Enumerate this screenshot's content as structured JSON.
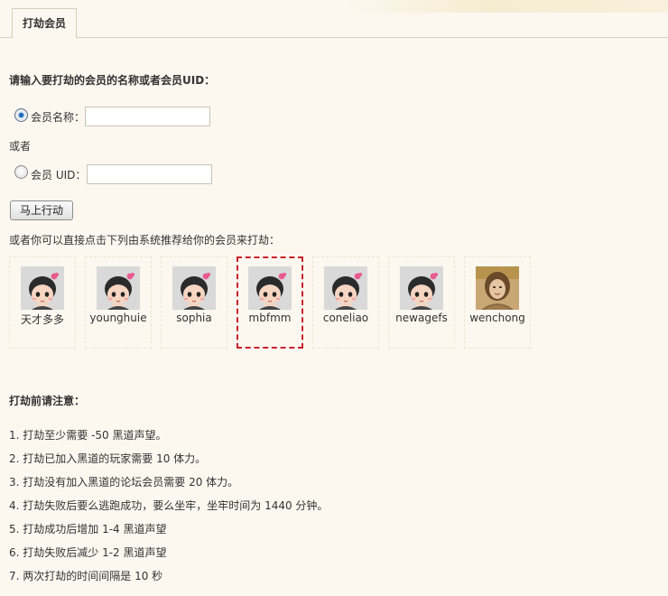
{
  "tab": {
    "label": "打劫会员"
  },
  "form": {
    "heading": "请输入要打劫的会员的名称或者会员UID：",
    "name_label": "会员名称：",
    "or_label": "或者",
    "uid_label": "会员 UID：",
    "name_value": "",
    "uid_value": "",
    "submit_label": "马上行动"
  },
  "recommend": {
    "label": "或者你可以直接点击下列由系统推荐给你的会员来打劫：",
    "members": [
      {
        "name": "天才多多",
        "avatar": "default-avatar",
        "selected": false
      },
      {
        "name": "younghuie",
        "avatar": "default-avatar",
        "selected": false
      },
      {
        "name": "sophia",
        "avatar": "default-avatar",
        "selected": false
      },
      {
        "name": "mbfmm",
        "avatar": "default-avatar",
        "selected": true
      },
      {
        "name": "coneliao",
        "avatar": "default-avatar",
        "selected": false
      },
      {
        "name": "newagefs",
        "avatar": "default-avatar",
        "selected": false
      },
      {
        "name": "wenchong",
        "avatar": "photo-avatar",
        "selected": false
      }
    ]
  },
  "notes": {
    "title": "打劫前请注意：",
    "items": [
      "1. 打劫至少需要 -50 黑道声望。",
      "2. 打劫已加入黑道的玩家需要 10 体力。",
      "3. 打劫没有加入黑道的论坛会员需要 20 体力。",
      "4. 打劫失败后要么逃跑成功，要么坐牢，坐牢时间为 1440 分钟。",
      "5. 打劫成功后增加 1-4 黑道声望",
      "6. 打劫失败后减少 1-2 黑道声望",
      "7. 两次打劫的时间间隔是 10 秒"
    ]
  },
  "colors": {
    "background": "#fcf8f0",
    "selected_border": "#c9202a",
    "radio_checked": "#2f78c4"
  }
}
